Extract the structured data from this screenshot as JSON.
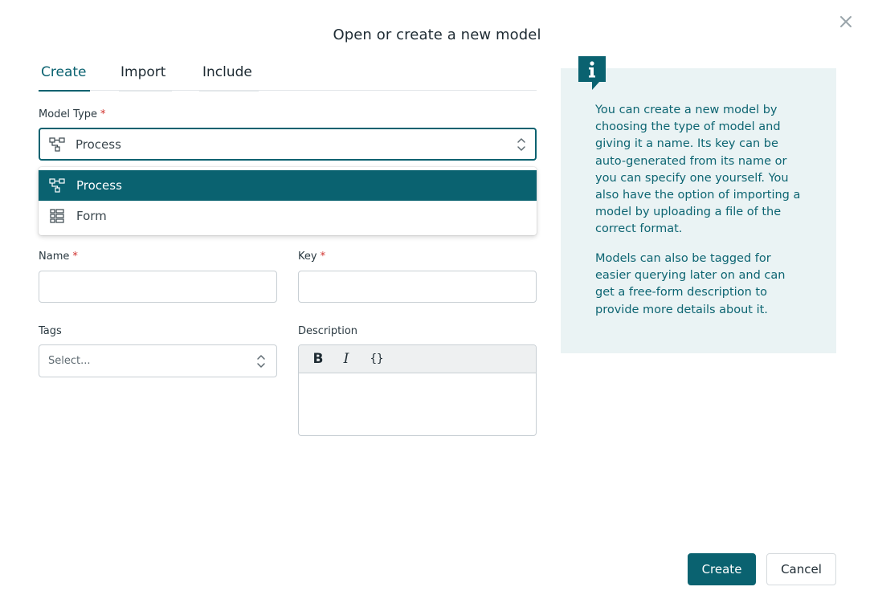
{
  "dialog": {
    "title": "Open or create a new model"
  },
  "tabs": [
    {
      "label": "Create",
      "active": true
    },
    {
      "label": "Import",
      "active": false
    },
    {
      "label": "Include",
      "active": false
    }
  ],
  "form": {
    "model_type": {
      "label": "Model Type",
      "required_mark": "*",
      "value": "Process",
      "icon": "process-icon",
      "options": [
        {
          "label": "Process",
          "icon": "process-icon",
          "selected": true
        },
        {
          "label": "Form",
          "icon": "form-icon",
          "selected": false
        }
      ]
    },
    "name": {
      "label": "Name",
      "required_mark": "*",
      "value": ""
    },
    "key": {
      "label": "Key",
      "required_mark": "*",
      "value": ""
    },
    "tags": {
      "label": "Tags",
      "placeholder": "Select..."
    },
    "description": {
      "label": "Description",
      "toolbar": {
        "bold": "B",
        "italic": "I",
        "code": "{}"
      },
      "value": ""
    }
  },
  "info": {
    "icon": "info-icon",
    "paragraph1": "You can create a new model by choosing the type of model and giving it a name. Its key can be auto-generated from its name or you can specify one yourself. You also have the option of importing a model by uploading a file of the correct format.",
    "paragraph2": "Models can also be tagged for easier querying later on and can get a free-form description to provide more details about it."
  },
  "actions": {
    "create_label": "Create",
    "cancel_label": "Cancel"
  },
  "colors": {
    "accent": "#0a6270",
    "info_background": "#eaf3f4",
    "required": "#d0312d"
  }
}
